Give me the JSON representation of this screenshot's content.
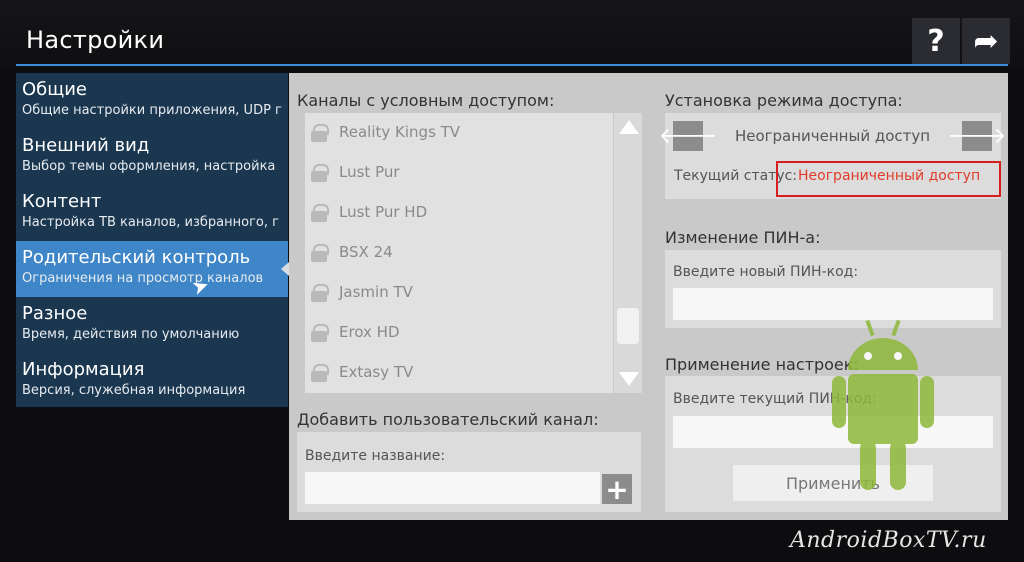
{
  "header": {
    "title": "Настройки",
    "help_icon": "?",
    "forward_icon": "➦"
  },
  "sidebar": {
    "items": [
      {
        "title": "Общие",
        "sub": "Общие настройки приложения, UDP г"
      },
      {
        "title": "Внешний вид",
        "sub": "Выбор темы оформления, настройка"
      },
      {
        "title": "Контент",
        "sub": "Настройка ТВ каналов, избранного, г"
      },
      {
        "title": "Родительский контроль",
        "sub": "Ограничения на просмотр каналов"
      },
      {
        "title": "Разное",
        "sub": "Время, действия по умолчанию"
      },
      {
        "title": "Информация",
        "sub": "Версия, служебная информация"
      }
    ],
    "active_index": 3
  },
  "channels": {
    "label": "Каналы с условным доступом:",
    "items": [
      "Reality Kings TV",
      "Lust Pur",
      "Lust Pur HD",
      "BSX 24",
      "Jasmin TV",
      "Erox HD",
      "Extasy TV"
    ]
  },
  "add_channel": {
    "label": "Добавить пользовательский канал:",
    "name_label": "Введите название:",
    "plus_icon": "+"
  },
  "access_mode": {
    "label": "Установка режима доступа:",
    "value": "Неограниченный доступ",
    "prev_icon": "🡐",
    "next_icon": "🡒",
    "status_label": "Текущий статус:",
    "status_value": "Неограниченный доступ"
  },
  "pin_change": {
    "label": "Изменение ПИН-а:",
    "new_pin_label": "Введите новый ПИН-код:"
  },
  "apply": {
    "label": "Применение настроек:",
    "current_pin_label": "Введите текущий ПИН-код:",
    "button": "Применить"
  },
  "watermark": "AndroidBoxTV.ru",
  "colors": {
    "accent": "#3f86c8",
    "sidebar_bg": "#1b3750",
    "status_red": "#e23b2a",
    "highlight_box": "#d61e1e"
  }
}
